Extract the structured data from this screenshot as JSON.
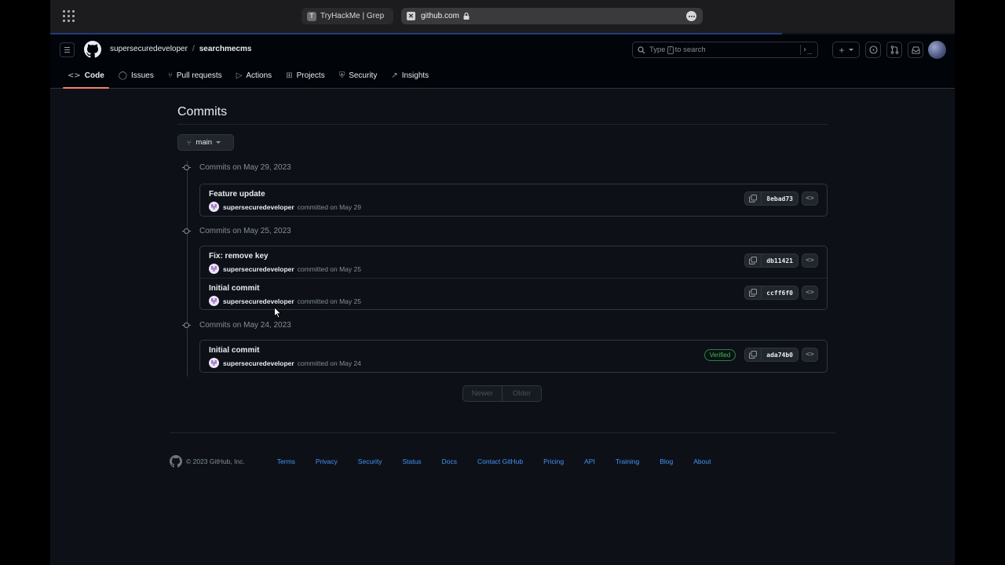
{
  "browser": {
    "tabs": [
      {
        "favicon": "T",
        "label": "TryHackMe | Grep"
      }
    ],
    "address": "github.com"
  },
  "header": {
    "owner": "supersecuredeveloper",
    "separator": "/",
    "repo": "searchmecms",
    "search_prefix": "Type",
    "search_key": "/",
    "search_suffix": "to search",
    "create_label": "+"
  },
  "repo_nav": [
    {
      "icon": "code-icon",
      "glyph": "<>",
      "label": "Code",
      "active": true
    },
    {
      "icon": "issues-icon",
      "glyph": "◯",
      "label": "Issues",
      "active": false
    },
    {
      "icon": "pull-request-icon",
      "glyph": "⑂",
      "label": "Pull requests",
      "active": false
    },
    {
      "icon": "actions-icon",
      "glyph": "▷",
      "label": "Actions",
      "active": false
    },
    {
      "icon": "projects-icon",
      "glyph": "⊞",
      "label": "Projects",
      "active": false
    },
    {
      "icon": "security-icon",
      "glyph": "⛨",
      "label": "Security",
      "active": false
    },
    {
      "icon": "insights-icon",
      "glyph": "↗",
      "label": "Insights",
      "active": false
    }
  ],
  "main": {
    "title": "Commits",
    "branch": "main",
    "groups": [
      {
        "heading": "Commits on May 29, 2023",
        "commits": [
          {
            "title": "Feature update",
            "author": "supersecuredeveloper",
            "committed": "committed on May 29",
            "sha": "8ebad73",
            "verified": false
          }
        ]
      },
      {
        "heading": "Commits on May 25, 2023",
        "commits": [
          {
            "title": "Fix: remove key",
            "author": "supersecuredeveloper",
            "committed": "committed on May 25",
            "sha": "db11421",
            "verified": false
          },
          {
            "title": "Initial commit",
            "author": "supersecuredeveloper",
            "committed": "committed on May 25",
            "sha": "ccff6f0",
            "verified": false
          }
        ]
      },
      {
        "heading": "Commits on May 24, 2023",
        "commits": [
          {
            "title": "Initial commit",
            "author": "supersecuredeveloper",
            "committed": "committed on May 24",
            "sha": "ada74b0",
            "verified": true,
            "verified_label": "Verified"
          }
        ]
      }
    ],
    "pager": {
      "newer": "Newer",
      "older": "Older"
    }
  },
  "footer": {
    "copyright": "© 2023 GitHub, Inc.",
    "links": [
      "Terms",
      "Privacy",
      "Security",
      "Status",
      "Docs",
      "Contact GitHub",
      "Pricing",
      "API",
      "Training",
      "Blog",
      "About"
    ]
  },
  "colors": {
    "background": "#0d1117",
    "header": "#010409",
    "accent_underline": "#f78166",
    "link": "#4493f8",
    "verified": "#3fb950"
  }
}
